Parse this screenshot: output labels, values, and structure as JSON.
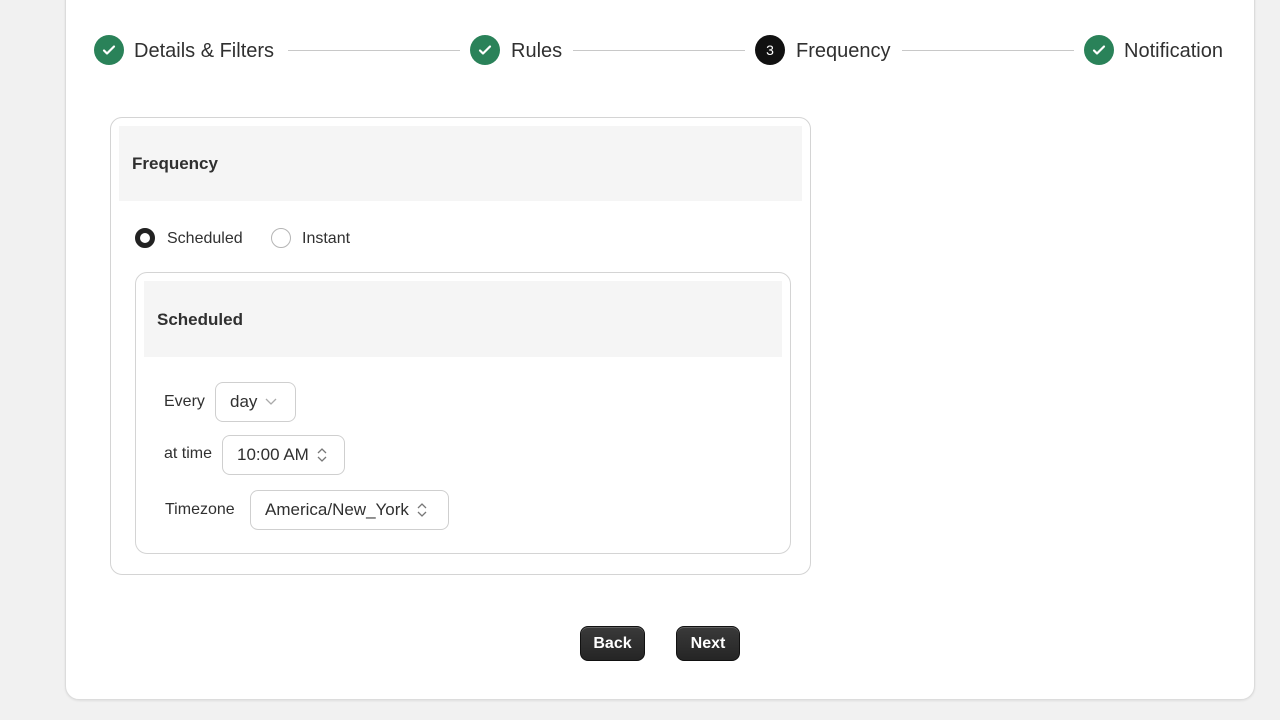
{
  "stepper": {
    "steps": [
      {
        "label": "Details & Filters",
        "status": "complete",
        "icon": "check-icon"
      },
      {
        "label": "Rules",
        "status": "complete",
        "icon": "check-icon"
      },
      {
        "label": "Frequency",
        "status": "current",
        "number": "3"
      },
      {
        "label": "Notification",
        "status": "complete",
        "icon": "check-icon"
      }
    ],
    "complete_color": "#2a8259"
  },
  "frequency": {
    "title": "Frequency",
    "options": [
      {
        "label": "Scheduled",
        "selected": true
      },
      {
        "label": "Instant",
        "selected": false
      }
    ],
    "scheduled": {
      "title": "Scheduled",
      "every_label": "Every",
      "every_value": "day",
      "time_label": "at time",
      "time_value": "10:00 AM",
      "timezone_label": "Timezone",
      "timezone_value": "America/New_York"
    }
  },
  "actions": {
    "back": "Back",
    "next": "Next"
  }
}
